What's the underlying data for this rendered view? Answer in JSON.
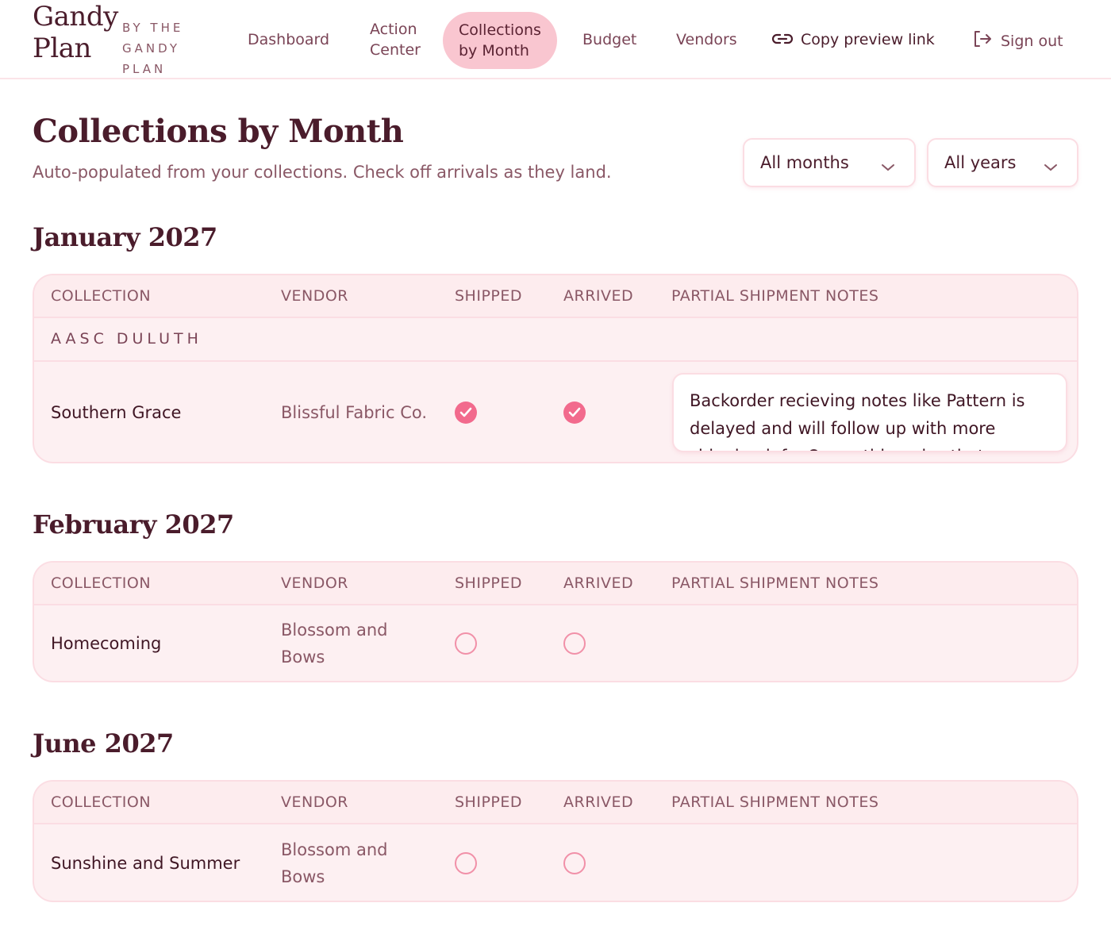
{
  "brand": {
    "name_line1": "Gandy",
    "name_line2": "Plan",
    "sub1": "BY THE",
    "sub2": "GANDY",
    "sub3": "PLAN"
  },
  "nav": {
    "dashboard": "Dashboard",
    "action_center_1": "Action",
    "action_center_2": "Center",
    "collections_1": "Collections",
    "collections_2": "by Month",
    "budget": "Budget",
    "vendors": "Vendors",
    "copy_link": "Copy preview link",
    "sign_out": "Sign out"
  },
  "page": {
    "title": "Collections by Month",
    "subtitle": "Auto-populated from your collections. Check off arrivals as they land."
  },
  "filters": {
    "month": "All months",
    "year": "All years"
  },
  "columns": {
    "collection": "COLLECTION",
    "vendor": "VENDOR",
    "shipped": "SHIPPED",
    "arrived": "ARRIVED",
    "notes": "PARTIAL SHIPMENT NOTES"
  },
  "months": [
    {
      "heading": "January 2027",
      "group": "AASC DULUTH",
      "rows": [
        {
          "collection": "Southern Grace",
          "vendor": "Blissful Fabric Co.",
          "shipped": true,
          "arrived": true,
          "notes": "Backorder recieving notes like Pattern is delayed and will follow up with more shipping info. Or anything else that"
        }
      ]
    },
    {
      "heading": "February 2027",
      "rows": [
        {
          "collection": "Homecoming",
          "vendor_l1": "Blossom and",
          "vendor_l2": "Bows",
          "shipped": false,
          "arrived": false
        }
      ]
    },
    {
      "heading": "June 2027",
      "rows": [
        {
          "collection": "Sunshine and Summer",
          "vendor_l1": "Blossom and",
          "vendor_l2": "Bows",
          "shipped": false,
          "arrived": false
        }
      ]
    }
  ],
  "colors": {
    "accent": "#f26a8d",
    "active_nav": "#f9c6d0",
    "card_bg": "#fdf0f2",
    "border": "#fbdde3",
    "text": "#4a1c2b"
  }
}
